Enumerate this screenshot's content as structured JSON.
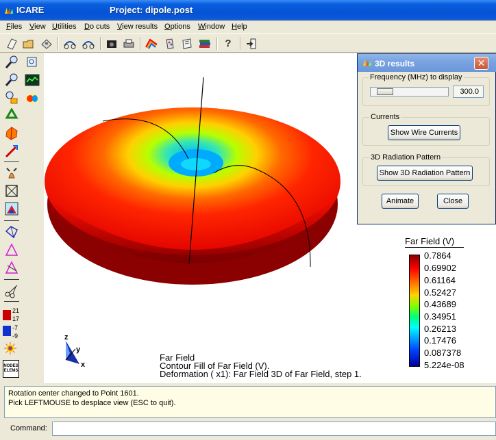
{
  "window": {
    "app_name": "ICARE",
    "project_title": "Project: dipole.post"
  },
  "menu": [
    {
      "label": "Files",
      "ul": "F",
      "rest": "iles"
    },
    {
      "label": "View",
      "ul": "V",
      "rest": "iew"
    },
    {
      "label": "Utilities",
      "ul": "U",
      "rest": "tilities"
    },
    {
      "label": "Do cuts",
      "ul": "D",
      "rest": "o cuts"
    },
    {
      "label": "View results",
      "ul": "V",
      "rest": "iew results"
    },
    {
      "label": "Options",
      "ul": "O",
      "rest": "ptions"
    },
    {
      "label": "Window",
      "ul": "W",
      "rest": "indow"
    },
    {
      "label": "Help",
      "ul": "H",
      "rest": "elp"
    }
  ],
  "legend_ranges": [
    {
      "top": "21",
      "bottom": "17",
      "color": "#cc0000"
    },
    {
      "top": "-7",
      "bottom": "-9",
      "color": "#1030d0"
    }
  ],
  "viewport": {
    "colorbar_title": "Far Field (V)",
    "colorbar_labels": [
      "0.7864",
      "0.69902",
      "0.61164",
      "0.52427",
      "0.43689",
      "0.34951",
      "0.26213",
      "0.17476",
      "0.087378",
      "5.224e-08"
    ],
    "annotations": [
      "Far Field",
      "Contour Fill of Far Field (V).",
      "Deformation ( x1): Far Field 3D of Far Field, step 1."
    ],
    "axes": {
      "z": "z",
      "y": "y",
      "x": "x"
    },
    "nodes_elems_label": "NODES\nELEMS"
  },
  "messages": [
    "Rotation center changed to Point 1601.",
    "Pick LEFTMOUSE to desplace view (ESC to quit)."
  ],
  "command": {
    "label": "Command:",
    "value": ""
  },
  "dialog": {
    "title": "3D results",
    "frequency_group": "Frequency (MHz) to display",
    "frequency_value": "300.0",
    "frequency_slider_fraction": 0.08,
    "currents_group": "Currents",
    "show_currents_button": "Show Wire Currents",
    "radiation_group": "3D Radiation Pattern",
    "show_radiation_button": "Show 3D Radiation Pattern",
    "animate_button": "Animate",
    "close_button": "Close",
    "close_glyph": "✕"
  },
  "colors": {
    "titlebar": "#0454d4",
    "viewport_bg": "#ffffff",
    "message_bg": "#fffde5"
  }
}
